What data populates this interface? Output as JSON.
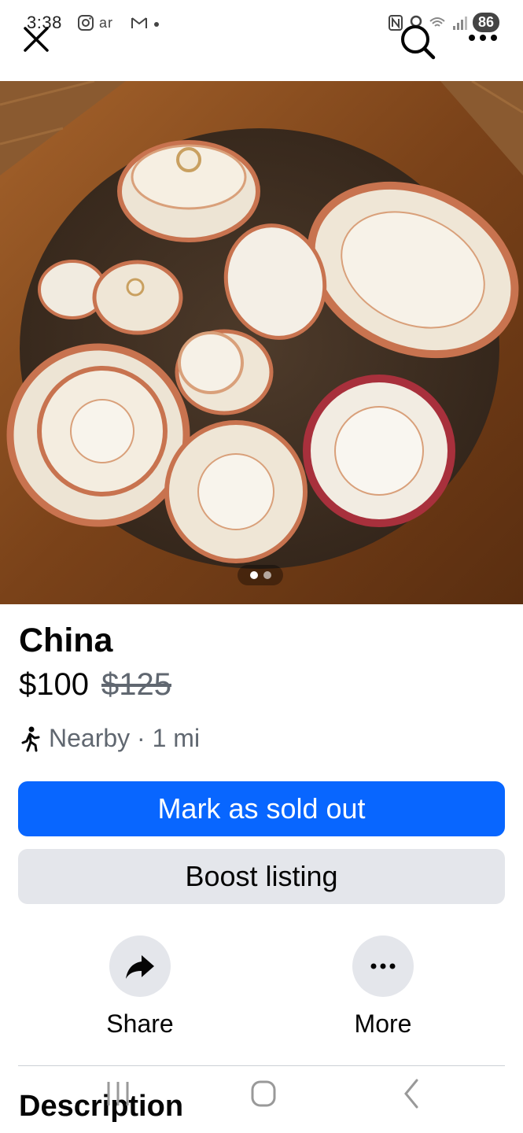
{
  "status_bar": {
    "time": "3:38",
    "battery": "86"
  },
  "listing": {
    "title": "China",
    "price": "$100",
    "original_price": "$125",
    "location": "Nearby · 1 mi"
  },
  "photos": {
    "count": 2,
    "current": 1
  },
  "buttons": {
    "mark_sold": "Mark as sold out",
    "boost": "Boost listing"
  },
  "actions": {
    "share": "Share",
    "more": "More"
  },
  "sections": {
    "description": "Description"
  },
  "colors": {
    "primary": "#0866ff",
    "secondary_bg": "#e4e6eb",
    "muted_text": "#606770"
  },
  "icons": [
    "close-icon",
    "search-icon",
    "more-icon",
    "walk-icon",
    "share-icon"
  ]
}
